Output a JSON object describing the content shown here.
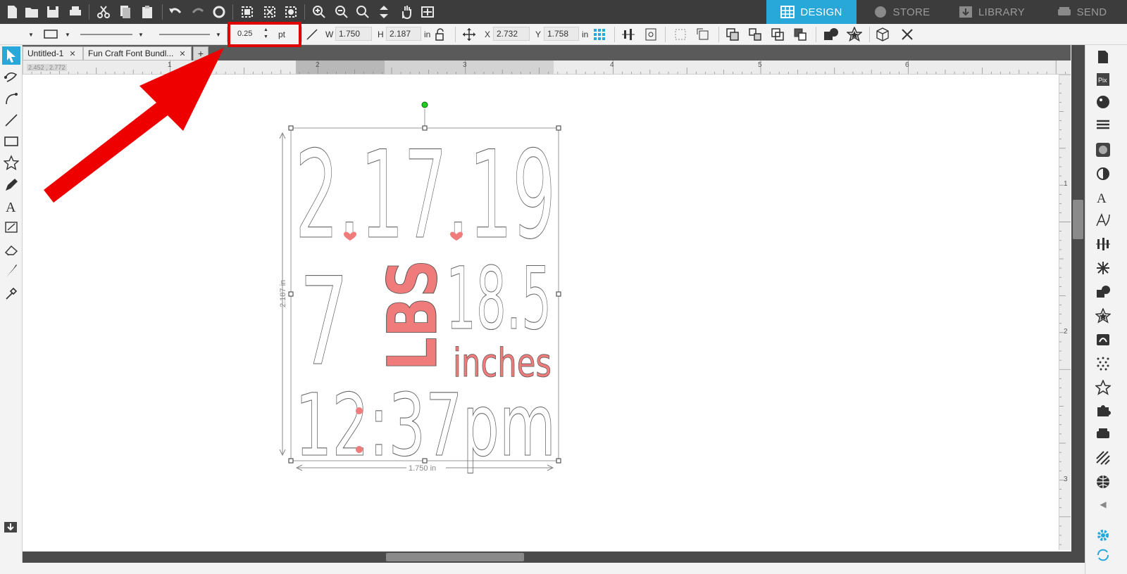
{
  "app_tabs": [
    {
      "label": "DESIGN",
      "icon": "grid-icon",
      "active": true
    },
    {
      "label": "STORE",
      "icon": "store-icon",
      "active": false
    },
    {
      "label": "LIBRARY",
      "icon": "library-icon",
      "active": false
    },
    {
      "label": "SEND",
      "icon": "send-icon",
      "active": false
    }
  ],
  "properties": {
    "line_weight": "0.25",
    "line_weight_unit": "pt",
    "width_label": "W",
    "width_value": "1.750",
    "height_label": "H",
    "height_value": "2.187",
    "size_unit": "in",
    "x_label": "X",
    "x_value": "2.732",
    "y_label": "Y",
    "y_value": "1.758",
    "pos_unit": "in"
  },
  "documents": [
    {
      "title": "Untitled-1"
    },
    {
      "title": "Fun Craft Font Bundl..."
    }
  ],
  "add_tab_label": "+",
  "ruler": {
    "cursor_readout": "2.452 , 2.772",
    "top_labels": [
      "1",
      "2",
      "3",
      "4",
      "5",
      "6"
    ],
    "right_labels": [
      "1",
      "2",
      "3"
    ]
  },
  "design": {
    "line1": "2.17.19",
    "line2_left": "7",
    "line2_lbs": "LBS",
    "line2_right": "18.5",
    "line2_inches": "inches",
    "line3": "12:37pm",
    "height_dim": "2.187 in",
    "width_dim": "1.750 in"
  },
  "colors": {
    "accent": "#27a8d8",
    "topbar": "#3c3c3c",
    "highlight": "#e00000",
    "design_fill": "#f07b7b",
    "handle_rotate": "#22cc22"
  }
}
